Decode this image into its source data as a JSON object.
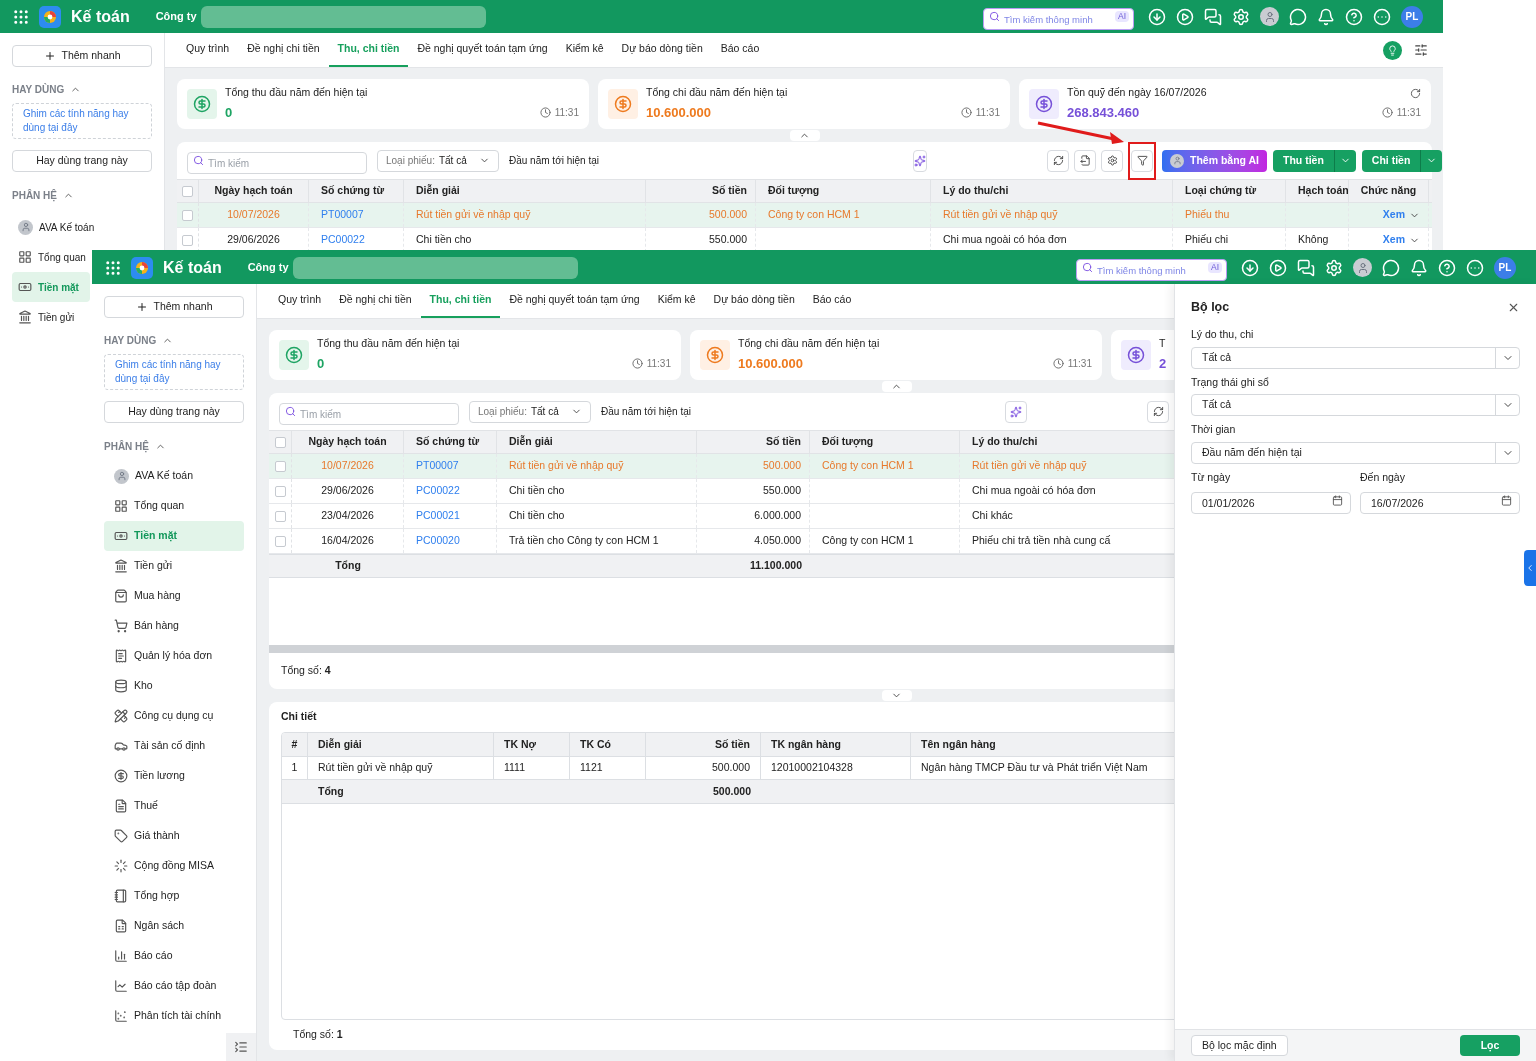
{
  "screens": [
    {
      "app": {
        "title": "Kế toán",
        "company": "Công ty"
      },
      "search": {
        "placeholder": "Tìm kiếm thông minh",
        "badge": "AI"
      },
      "user_initials": "PL",
      "sidebar": {
        "quick_add": "Thêm nhanh",
        "favorites": {
          "title": "HAY DÙNG",
          "expanded": true,
          "hint": "Ghim các tính năng hay dùng tại đây",
          "button": "Hay dùng trang này"
        },
        "modules": {
          "title": "PHÂN HỆ",
          "expanded": true,
          "items": [
            {
              "label": "AVA Kế toán",
              "selected": false
            },
            {
              "label": "Tổng quan",
              "selected": false
            },
            {
              "label": "Tiền mặt",
              "selected": true
            },
            {
              "label": "Tiền gửi",
              "selected": false
            }
          ]
        }
      },
      "tabs": [
        {
          "label": "Quy trình",
          "selected": false
        },
        {
          "label": "Đề nghị chi tiền",
          "selected": false
        },
        {
          "label": "Thu, chi tiền",
          "selected": true
        },
        {
          "label": "Đề nghị quyết toán tạm ứng",
          "selected": false
        },
        {
          "label": "Kiểm kê",
          "selected": false
        },
        {
          "label": "Dự báo dòng tiền",
          "selected": false
        },
        {
          "label": "Báo cáo",
          "selected": false
        }
      ],
      "view_tools": true,
      "cards": [
        {
          "kind": "income",
          "title": "Tổng thu đầu năm đến hiện tại",
          "value": "0",
          "time": "11:31"
        },
        {
          "kind": "expense",
          "title": "Tổng chi đầu năm đến hiện tại",
          "value": "10.600.000",
          "time": "11:31"
        },
        {
          "kind": "balance",
          "title": "Tồn quỹ đến ngày 16/07/2026",
          "value": "268.843.460",
          "time": "11:31"
        }
      ],
      "toolbar": {
        "search_placeholder": "Tìm kiếm",
        "type_label": "Loại phiếu:",
        "type_value": "Tất cả",
        "period": "Đầu năm tới hiện tại",
        "tools": [
          {
            "kind": "refresh",
            "highlighted": false
          },
          {
            "kind": "export",
            "highlighted": false
          },
          {
            "kind": "settings",
            "highlighted": false
          },
          {
            "kind": "filter",
            "highlighted": true
          }
        ],
        "actions": [
          {
            "kind": "ai",
            "label": "Thêm bằng AI"
          },
          {
            "kind": "split",
            "label": "Thu tiền"
          },
          {
            "kind": "split",
            "label": "Chi tiền"
          }
        ]
      },
      "table": {
        "all_checked": false,
        "columns": [
          {
            "label": "Ngày hạch toán",
            "kind": "date"
          },
          {
            "label": "Số chứng từ",
            "kind": "link"
          },
          {
            "label": "Diễn giải",
            "kind": "text"
          },
          {
            "label": "Số tiền",
            "kind": "amount"
          },
          {
            "label": "Đối tượng",
            "kind": "text"
          },
          {
            "label": "Lý do thu/chi",
            "kind": "text"
          },
          {
            "label": "Loại chứng từ",
            "kind": "text"
          },
          {
            "label": "Hạch toán",
            "kind": "text"
          },
          {
            "label": "Chức năng",
            "kind": "action"
          }
        ],
        "rows": [
          {
            "selected": true,
            "checked": false,
            "cells": [
              "10/07/2026",
              "PT00007",
              "Rút tiền gửi về nhập quỹ",
              "500.000",
              "Công ty con HCM 1",
              "Rút tiền gửi về nhập quỹ",
              "Phiếu thu",
              null,
              "Xem"
            ]
          },
          {
            "selected": false,
            "checked": false,
            "cells": [
              "29/06/2026",
              "PC00022",
              "Chi tiền cho",
              "550.000",
              null,
              "Chi mua ngoài có hóa đơn",
              "Phiếu chi",
              "Không",
              "Xem"
            ]
          }
        ]
      }
    },
    {
      "app": {
        "title": "Kế toán",
        "company": "Công ty"
      },
      "search": {
        "placeholder": "Tìm kiếm thông minh",
        "badge": "AI"
      },
      "user_initials": "PL",
      "sidebar": {
        "quick_add": "Thêm nhanh",
        "favorites": {
          "title": "HAY DÙNG",
          "expanded": true,
          "hint": "Ghim các tính năng hay dùng tại đây",
          "button": "Hay dùng trang này"
        },
        "modules": {
          "title": "PHÂN HỆ",
          "expanded": true,
          "items": [
            {
              "label": "AVA Kế toán",
              "selected": false
            },
            {
              "label": "Tổng quan",
              "selected": false
            },
            {
              "label": "Tiền mặt",
              "selected": true
            },
            {
              "label": "Tiền gửi",
              "selected": false
            },
            {
              "label": "Mua hàng",
              "selected": false
            },
            {
              "label": "Bán hàng",
              "selected": false
            },
            {
              "label": "Quản lý hóa đơn",
              "selected": false
            },
            {
              "label": "Kho",
              "selected": false
            },
            {
              "label": "Công cụ dụng cụ",
              "selected": false
            },
            {
              "label": "Tài sản cố định",
              "selected": false
            },
            {
              "label": "Tiền lương",
              "selected": false
            },
            {
              "label": "Thuế",
              "selected": false
            },
            {
              "label": "Giá thành",
              "selected": false
            },
            {
              "label": "Cộng đồng MISA",
              "selected": false
            },
            {
              "label": "Tổng hợp",
              "selected": false
            },
            {
              "label": "Ngân sách",
              "selected": false
            },
            {
              "label": "Báo cáo",
              "selected": false
            },
            {
              "label": "Báo cáo tập đoàn",
              "selected": false
            },
            {
              "label": "Phân tích tài chính",
              "selected": false
            }
          ]
        }
      },
      "tabs": [
        {
          "label": "Quy trình",
          "selected": false
        },
        {
          "label": "Đề nghị chi tiền",
          "selected": false
        },
        {
          "label": "Thu, chi tiền",
          "selected": true
        },
        {
          "label": "Đề nghị quyết toán tạm ứng",
          "selected": false
        },
        {
          "label": "Kiểm kê",
          "selected": false
        },
        {
          "label": "Dự báo dòng tiền",
          "selected": false
        },
        {
          "label": "Báo cáo",
          "selected": false
        }
      ],
      "cards": [
        {
          "kind": "income",
          "title": "Tổng thu đầu năm đến hiện tại",
          "value": "0",
          "time": "11:31"
        },
        {
          "kind": "expense",
          "title": "Tổng chi đầu năm đến hiện tại",
          "value": "10.600.000",
          "time": "11:31"
        },
        {
          "kind": "balance",
          "title": "T",
          "value": "2"
        }
      ],
      "toolbar": {
        "search_placeholder": "Tìm kiếm",
        "type_label": "Loại phiếu:",
        "type_value": "Tất cả",
        "period": "Đầu năm tới hiện tại",
        "tools": [
          {
            "kind": "refresh",
            "highlighted": false
          }
        ]
      },
      "table": {
        "all_checked": false,
        "columns": [
          {
            "label": "Ngày hạch toán",
            "kind": "date",
            "total": "Tổng"
          },
          {
            "label": "Số chứng từ",
            "kind": "link"
          },
          {
            "label": "Diễn giải",
            "kind": "text"
          },
          {
            "label": "Số tiền",
            "kind": "amount",
            "total": "11.100.000"
          },
          {
            "label": "Đối tượng",
            "kind": "text"
          },
          {
            "label": "Lý do thu/chi",
            "kind": "text"
          }
        ],
        "rows": [
          {
            "selected": true,
            "checked": false,
            "cells": [
              "10/07/2026",
              "PT00007",
              "Rút tiền gửi về nhập quỹ",
              "500.000",
              "Công ty con HCM 1",
              "Rút tiền gửi về nhập quỹ"
            ]
          },
          {
            "selected": false,
            "checked": false,
            "cells": [
              "29/06/2026",
              "PC00022",
              "Chi tiền cho",
              "550.000",
              null,
              "Chi mua ngoài có hóa đơn"
            ]
          },
          {
            "selected": false,
            "checked": false,
            "cells": [
              "23/04/2026",
              "PC00021",
              "Chi tiền cho",
              "6.000.000",
              null,
              "Chi khác"
            ]
          },
          {
            "selected": false,
            "checked": false,
            "cells": [
              "16/04/2026",
              "PC00020",
              "Trả tiền cho Công ty con HCM 1",
              "4.050.000",
              "Công ty con HCM 1",
              "Phiếu chi trả tiền nhà cung cấ"
            ]
          }
        ],
        "footer": "Tổng số: **4**"
      },
      "detail": {
        "title": "Chi tiết",
        "columns": [
          {
            "label": "#",
            "kind": "index"
          },
          {
            "label": "Diễn giải",
            "kind": "text",
            "total": "Tổng"
          },
          {
            "label": "TK Nợ",
            "kind": "text"
          },
          {
            "label": "TK Có",
            "kind": "text"
          },
          {
            "label": "Số tiền",
            "kind": "amount",
            "total": "500.000"
          },
          {
            "label": "TK ngân hàng",
            "kind": "text"
          },
          {
            "label": "Tên ngân hàng",
            "kind": "text"
          }
        ],
        "rows": [
          {
            "cells": [
              "1",
              "Rút tiền gửi về nhập quỹ",
              "1111",
              "1121",
              "500.000",
              "12010002104328",
              "Ngân hàng TMCP Đầu tư và Phát triển Việt Nam"
            ]
          }
        ],
        "footer": "Tổng số: **1**"
      },
      "filter_panel": {
        "title": "Bộ lọc",
        "fields": [
          {
            "kind": "select",
            "label": "Lý do thu, chi",
            "value": "Tất cả"
          },
          {
            "kind": "select",
            "label": "Trạng thái ghi sổ",
            "value": "Tất cả"
          },
          {
            "kind": "select",
            "label": "Thời gian",
            "value": "Đầu năm đến hiện tại"
          },
          {
            "kind": "date",
            "label": "Từ ngày",
            "value": "01/01/2026"
          },
          {
            "kind": "date",
            "label": "Đến ngày",
            "value": "16/07/2026"
          }
        ],
        "buttons": [
          {
            "kind": "secondary",
            "label": "Bộ lọc mặc định"
          },
          {
            "kind": "primary",
            "label": "Lọc"
          }
        ]
      }
    }
  ]
}
